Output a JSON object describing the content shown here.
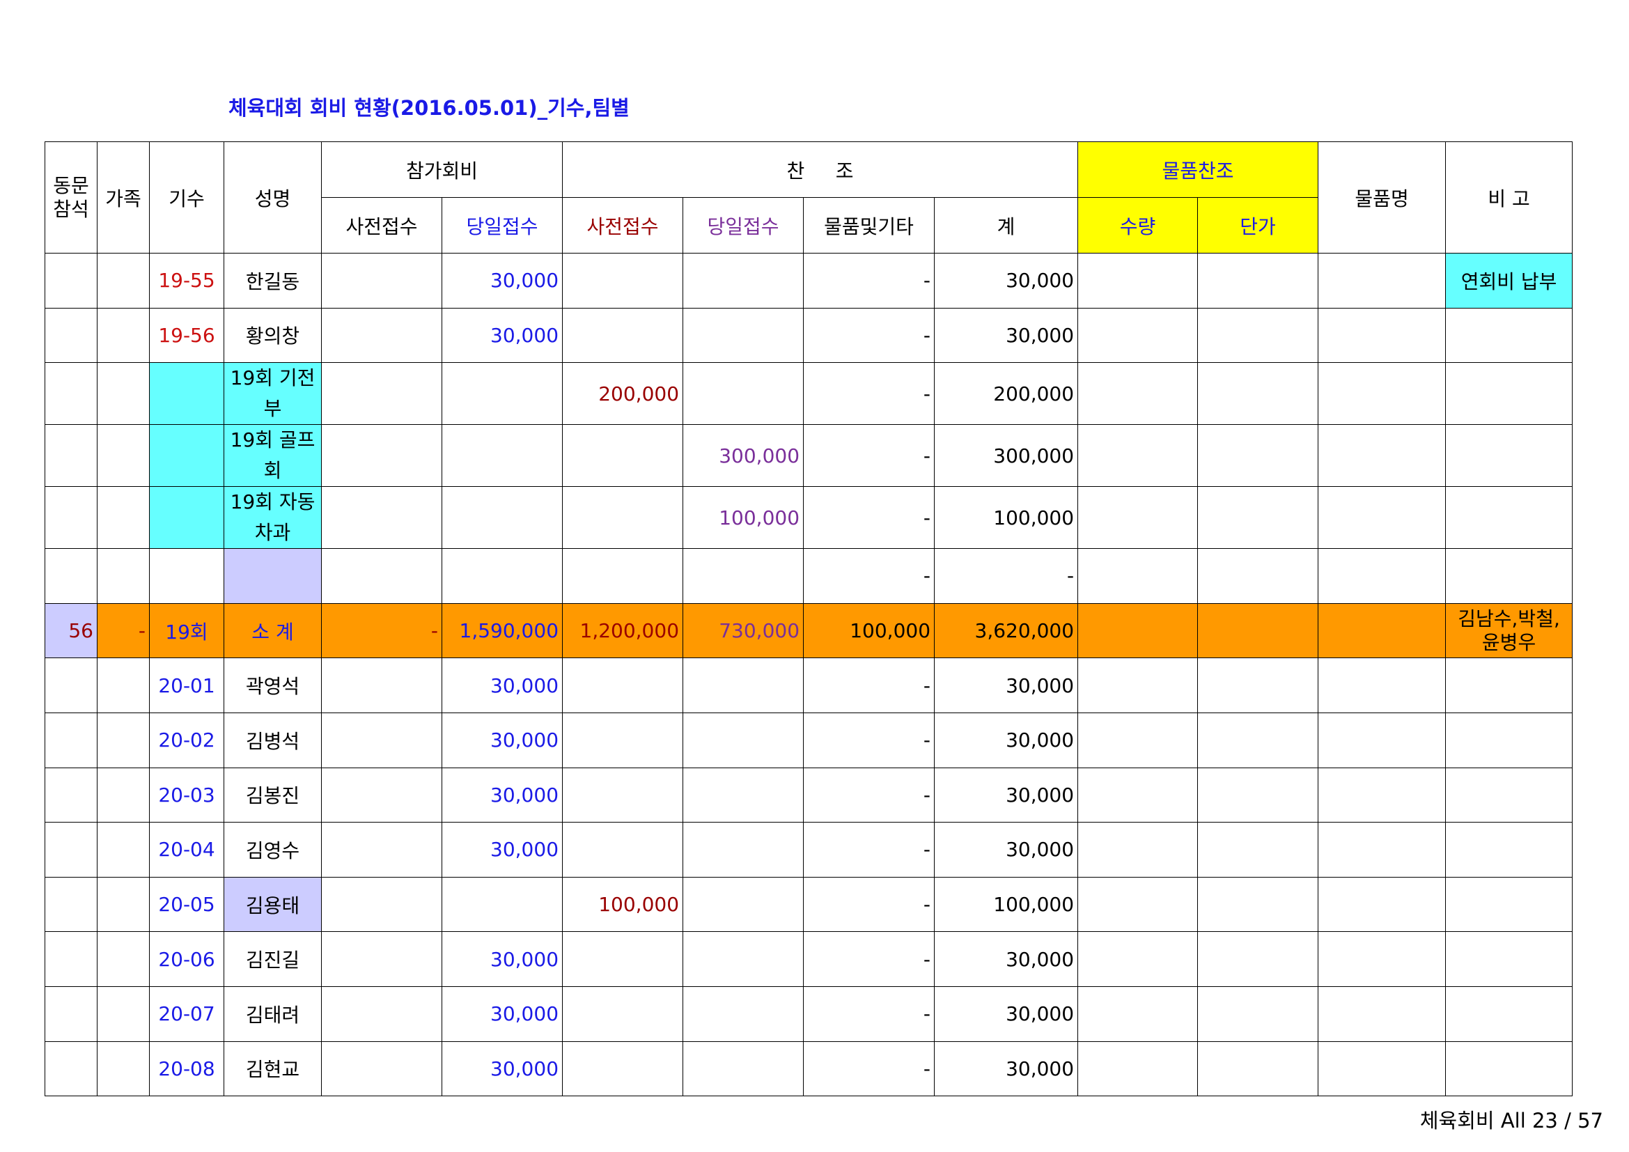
{
  "title": "체육대회 회비 현황(2016.05.01)_기수,팀별",
  "header": {
    "dongmun": "동문 참석",
    "family": "가족",
    "gisu": "기수",
    "name": "성명",
    "entry_fee": "참가회비",
    "sponsor": "찬     조",
    "goods_sponsor": "물품찬조",
    "goods_name": "물품명",
    "remarks": "비 고",
    "pre_receipt": "사전접수",
    "same_day_receipt": "당일접수",
    "sp_pre_receipt": "사전접수",
    "sp_same_day_receipt": "당일접수",
    "goods_etc": "물품및기타",
    "total": "계",
    "quantity": "수량",
    "unit_price": "단가"
  },
  "rows": [
    {
      "att": "",
      "fam": "",
      "gisu": "19-55",
      "name": "한길동",
      "pre": "",
      "day": "30,000",
      "sp_pre": "",
      "sp_day": "",
      "etc": "-",
      "total": "30,000",
      "qty": "",
      "price": "",
      "goods": "",
      "note": "연회비 납부"
    },
    {
      "att": "",
      "fam": "",
      "gisu": "19-56",
      "name": "황의창",
      "pre": "",
      "day": "30,000",
      "sp_pre": "",
      "sp_day": "",
      "etc": "-",
      "total": "30,000",
      "qty": "",
      "price": "",
      "goods": "",
      "note": ""
    },
    {
      "att": "",
      "fam": "",
      "gisu": "",
      "name": "19회 기전부",
      "pre": "",
      "day": "",
      "sp_pre": "200,000",
      "sp_day": "",
      "etc": "-",
      "total": "200,000",
      "qty": "",
      "price": "",
      "goods": "",
      "note": ""
    },
    {
      "att": "",
      "fam": "",
      "gisu": "",
      "name": "19회 골프회",
      "pre": "",
      "day": "",
      "sp_pre": "",
      "sp_day": "300,000",
      "etc": "-",
      "total": "300,000",
      "qty": "",
      "price": "",
      "goods": "",
      "note": ""
    },
    {
      "att": "",
      "fam": "",
      "gisu": "",
      "name": "19회 자동차과",
      "pre": "",
      "day": "",
      "sp_pre": "",
      "sp_day": "100,000",
      "etc": "-",
      "total": "100,000",
      "qty": "",
      "price": "",
      "goods": "",
      "note": ""
    },
    {
      "att": "",
      "fam": "",
      "gisu": "",
      "name": "",
      "pre": "",
      "day": "",
      "sp_pre": "",
      "sp_day": "",
      "etc": "-",
      "total": "-",
      "qty": "",
      "price": "",
      "goods": "",
      "note": ""
    },
    {
      "att": "56",
      "fam": "-",
      "gisu": "19회",
      "name": "소   계",
      "pre": "-",
      "day": "1,590,000",
      "sp_pre": "1,200,000",
      "sp_day": "730,000",
      "etc": "100,000",
      "total": "3,620,000",
      "qty": "",
      "price": "",
      "goods": "",
      "note": "김남수,박철, 윤병우"
    },
    {
      "att": "",
      "fam": "",
      "gisu": "20-01",
      "name": "곽영석",
      "pre": "",
      "day": "30,000",
      "sp_pre": "",
      "sp_day": "",
      "etc": "-",
      "total": "30,000",
      "qty": "",
      "price": "",
      "goods": "",
      "note": ""
    },
    {
      "att": "",
      "fam": "",
      "gisu": "20-02",
      "name": "김병석",
      "pre": "",
      "day": "30,000",
      "sp_pre": "",
      "sp_day": "",
      "etc": "-",
      "total": "30,000",
      "qty": "",
      "price": "",
      "goods": "",
      "note": ""
    },
    {
      "att": "",
      "fam": "",
      "gisu": "20-03",
      "name": "김봉진",
      "pre": "",
      "day": "30,000",
      "sp_pre": "",
      "sp_day": "",
      "etc": "-",
      "total": "30,000",
      "qty": "",
      "price": "",
      "goods": "",
      "note": ""
    },
    {
      "att": "",
      "fam": "",
      "gisu": "20-04",
      "name": "김영수",
      "pre": "",
      "day": "30,000",
      "sp_pre": "",
      "sp_day": "",
      "etc": "-",
      "total": "30,000",
      "qty": "",
      "price": "",
      "goods": "",
      "note": ""
    },
    {
      "att": "",
      "fam": "",
      "gisu": "20-05",
      "name": "김용태",
      "pre": "",
      "day": "",
      "sp_pre": "100,000",
      "sp_day": "",
      "etc": "-",
      "total": "100,000",
      "qty": "",
      "price": "",
      "goods": "",
      "note": ""
    },
    {
      "att": "",
      "fam": "",
      "gisu": "20-06",
      "name": "김진길",
      "pre": "",
      "day": "30,000",
      "sp_pre": "",
      "sp_day": "",
      "etc": "-",
      "total": "30,000",
      "qty": "",
      "price": "",
      "goods": "",
      "note": ""
    },
    {
      "att": "",
      "fam": "",
      "gisu": "20-07",
      "name": "김태려",
      "pre": "",
      "day": "30,000",
      "sp_pre": "",
      "sp_day": "",
      "etc": "-",
      "total": "30,000",
      "qty": "",
      "price": "",
      "goods": "",
      "note": ""
    },
    {
      "att": "",
      "fam": "",
      "gisu": "20-08",
      "name": "김현교",
      "pre": "",
      "day": "30,000",
      "sp_pre": "",
      "sp_day": "",
      "etc": "-",
      "total": "30,000",
      "qty": "",
      "price": "",
      "goods": "",
      "note": ""
    }
  ],
  "footer": "체육회비 All 23 / 57",
  "colors": {
    "header_yellow": "#ffff00",
    "cyan": "#66ffff",
    "lavender": "#ccccff",
    "subtotal_orange": "#ff9900",
    "blue_text": "#1a1ae6",
    "red_text": "#cc1111",
    "darkred_text": "#990000",
    "purple_text": "#7a2f9a"
  }
}
